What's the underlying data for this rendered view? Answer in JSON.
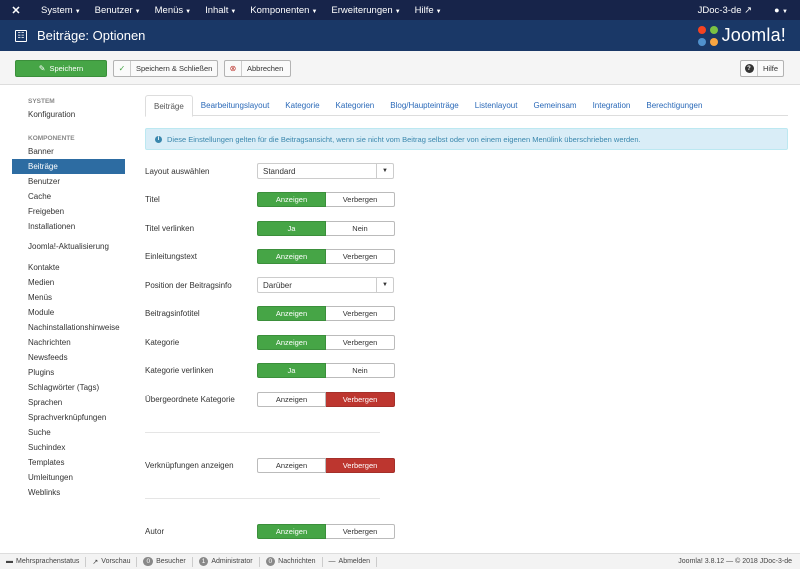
{
  "topnav": {
    "menu": [
      "System",
      "Benutzer",
      "Menüs",
      "Inhalt",
      "Komponenten",
      "Erweiterungen",
      "Hilfe"
    ],
    "site": "JDoc-3-de",
    "user_icon": "user-icon"
  },
  "header": {
    "title": "Beiträge: Optionen",
    "brand": "Joomla!"
  },
  "toolbar": {
    "save": "Speichern",
    "save_close": "Speichern & Schließen",
    "cancel": "Abbrechen",
    "help": "Hilfe"
  },
  "sidebar": {
    "system_heading": "SYSTEM",
    "system_items": [
      "Konfiguration"
    ],
    "component_heading": "KOMPONENTE",
    "items": [
      "Banner",
      "Beiträge",
      "Benutzer",
      "Cache",
      "Freigeben",
      "Installationen",
      "Joomla!-Aktualisierung",
      "Kontakte",
      "Medien",
      "Menüs",
      "Module",
      "Nachinstallationshinweise",
      "Nachrichten",
      "Newsfeeds",
      "Plugins",
      "Schlagwörter (Tags)",
      "Sprachen",
      "Sprachverknüpfungen",
      "Suche",
      "Suchindex",
      "Templates",
      "Umleitungen",
      "Weblinks"
    ],
    "active": "Beiträge"
  },
  "tabs": [
    "Beiträge",
    "Bearbeitungslayout",
    "Kategorie",
    "Kategorien",
    "Blog/Haupteinträge",
    "Listenlayout",
    "Gemeinsam",
    "Integration",
    "Berechtigungen"
  ],
  "alert": "Diese Einstellungen gelten für die Beitragsansicht, wenn sie nicht vom Beitrag selbst oder von einem eigenen Menülink überschrieben werden.",
  "fields": {
    "layout": {
      "label": "Layout auswählen",
      "value": "Standard"
    },
    "title": {
      "label": "Titel",
      "on": "Anzeigen",
      "off": "Verbergen",
      "selected": "on"
    },
    "title_link": {
      "label": "Titel verlinken",
      "on": "Ja",
      "off": "Nein",
      "selected": "on"
    },
    "intro": {
      "label": "Einleitungstext",
      "on": "Anzeigen",
      "off": "Verbergen",
      "selected": "on"
    },
    "info_pos": {
      "label": "Position der Beitragsinfo",
      "value": "Darüber"
    },
    "info_title": {
      "label": "Beitragsinfotitel",
      "on": "Anzeigen",
      "off": "Verbergen",
      "selected": "on"
    },
    "category": {
      "label": "Kategorie",
      "on": "Anzeigen",
      "off": "Verbergen",
      "selected": "on"
    },
    "category_link": {
      "label": "Kategorie verlinken",
      "on": "Ja",
      "off": "Nein",
      "selected": "on"
    },
    "parent_category": {
      "label": "Übergeordnete Kategorie",
      "on": "Anzeigen",
      "off": "Verbergen",
      "selected": "off"
    },
    "associations": {
      "label": "Verknüpfungen anzeigen",
      "on": "Anzeigen",
      "off": "Verbergen",
      "selected": "off"
    },
    "author": {
      "label": "Autor",
      "on": "Anzeigen",
      "off": "Verbergen",
      "selected": "on"
    }
  },
  "status": {
    "multilang": "Mehrsprachenstatus",
    "preview": "Vorschau",
    "visitors_count": "0",
    "visitors": "Besucher",
    "admins_count": "1",
    "admins": "Administrator",
    "messages_count": "0",
    "messages": "Nachrichten",
    "logout": "Abmelden",
    "version": "Joomla! 3.8.12 — © 2018 JDoc-3-de"
  },
  "colors": {
    "navbar": "#17244a",
    "header": "#1a3867",
    "green": "#46a546",
    "red": "#bd362f",
    "active": "#2d6ca2"
  }
}
